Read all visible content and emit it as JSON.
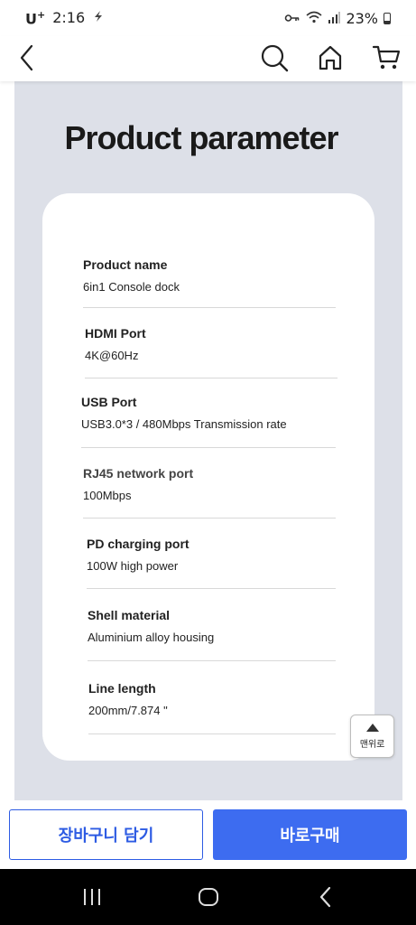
{
  "status_bar": {
    "carrier": "U",
    "carrier_sup": "+",
    "time": "2:16",
    "battery": "23%"
  },
  "nav": {
    "icons": [
      "back-icon",
      "search-icon",
      "home-icon",
      "cart-icon"
    ]
  },
  "product": {
    "title": "Product parameter",
    "specs": [
      {
        "name": "Product name",
        "value": "6in1 Console dock"
      },
      {
        "name": "HDMI Port",
        "value": "4K@60Hz"
      },
      {
        "name": "USB Port",
        "value": "USB3.0*3 / 480Mbps Transmission rate"
      },
      {
        "name": "RJ45 network port",
        "value": "100Mbps"
      },
      {
        "name": "PD charging port",
        "value": "100W high power"
      },
      {
        "name": "Shell material",
        "value": "Aluminium alloy housing"
      },
      {
        "name": "Line length",
        "value": "200mm/7.874 \""
      }
    ]
  },
  "scroll_top": {
    "label": "맨위로"
  },
  "actions": {
    "cart_label": "장바구니 담기",
    "buy_label": "바로구매"
  },
  "colors": {
    "accent": "#3d6cf0",
    "content_bg": "#dde0e8"
  }
}
